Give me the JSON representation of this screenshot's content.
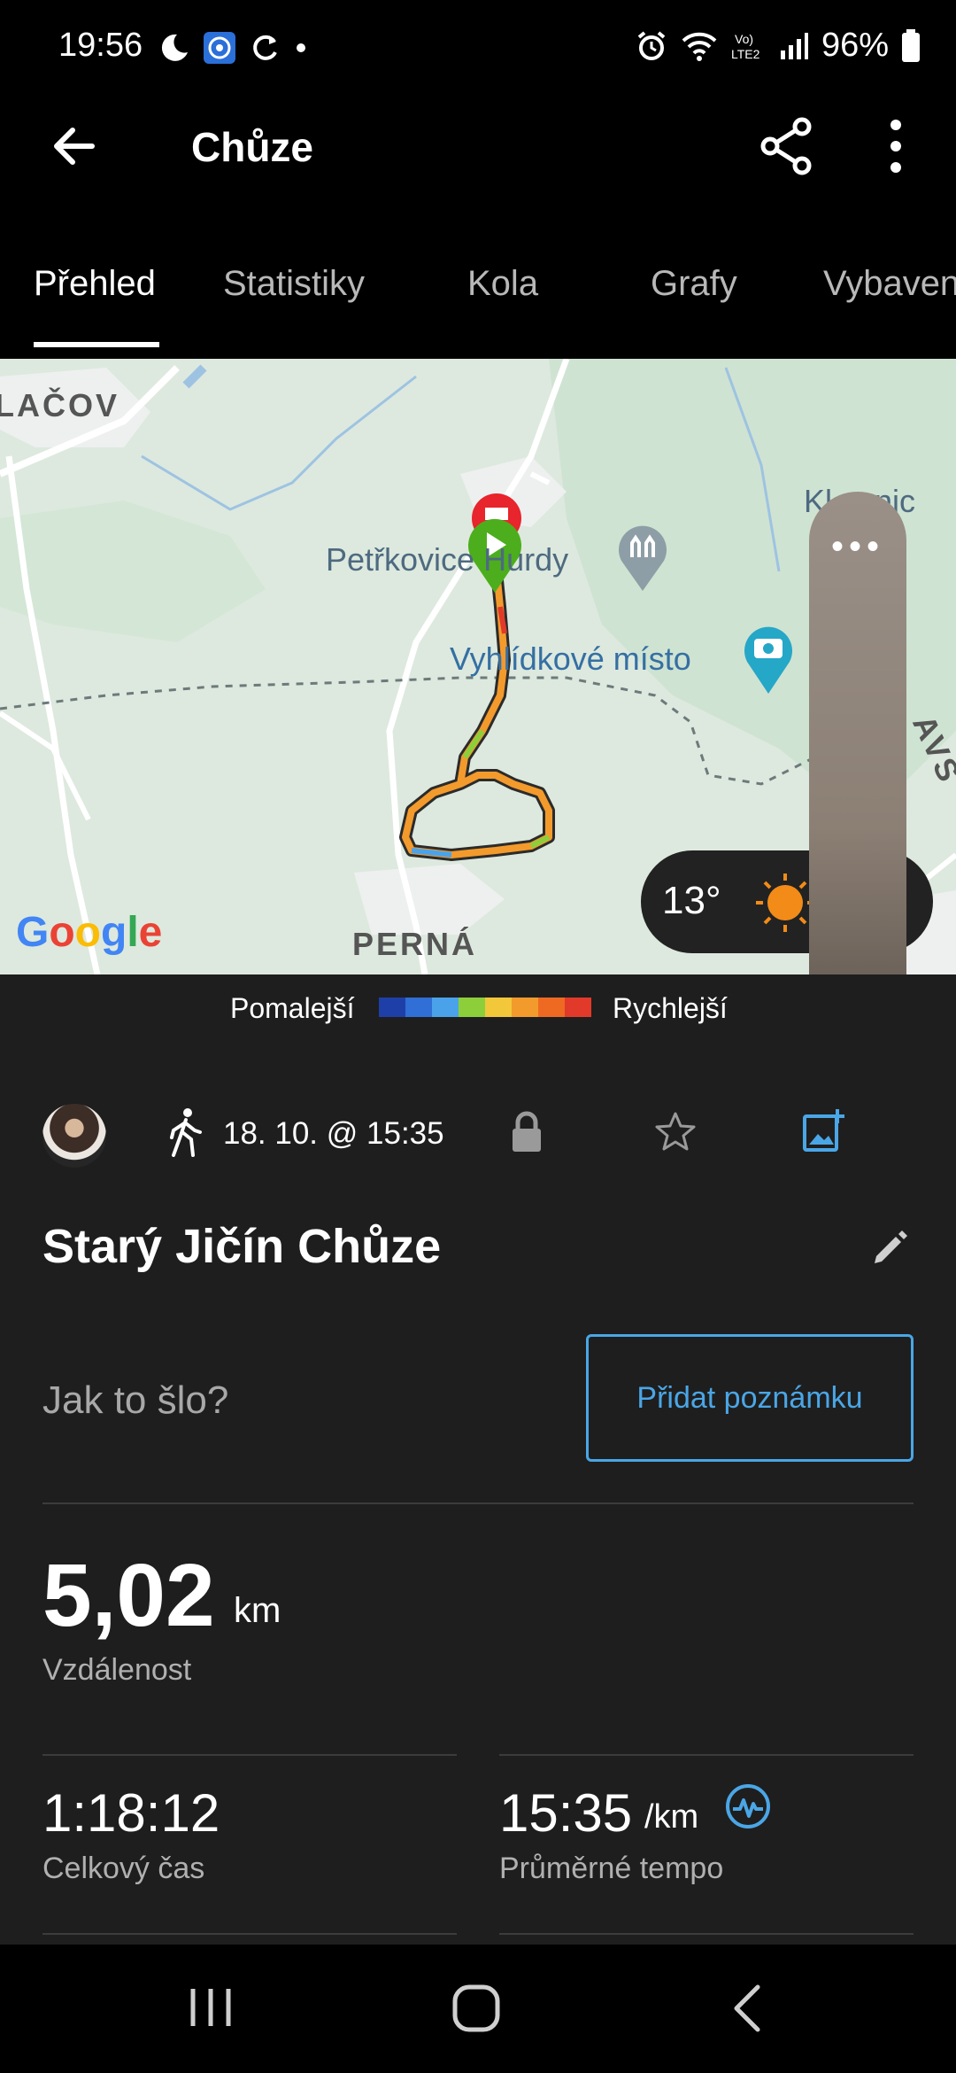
{
  "status_bar": {
    "time": "19:56",
    "battery": "96%",
    "network": "LTE2",
    "icons": [
      "moon-icon",
      "app-notification-icon",
      "sync-icon",
      "dot-icon",
      "alarm-icon",
      "wifi-icon",
      "signal-icon",
      "battery-icon"
    ]
  },
  "app_bar": {
    "title": "Chůze"
  },
  "tabs": [
    {
      "label": "Přehled",
      "active": true
    },
    {
      "label": "Statistiky",
      "active": false
    },
    {
      "label": "Kola",
      "active": false
    },
    {
      "label": "Grafy",
      "active": false
    },
    {
      "label": "Vybaven",
      "active": false
    }
  ],
  "map": {
    "labels": {
      "town_left": "LAČOV",
      "place_top": "Petřkovice Hurdy",
      "viewpoint": "Vyhlídkové místo",
      "town_bottom": "PERNÁ",
      "place_right": "Kl senic",
      "place_right2": "AVS"
    },
    "provider": "Google",
    "weather": {
      "temperature": "13°",
      "icon": "sun-icon"
    },
    "pill_menu": "•••"
  },
  "legend": {
    "slow": "Pomalejší",
    "fast": "Rychlejší",
    "colors": [
      "#1f3fa8",
      "#2f6fd6",
      "#4aa3ea",
      "#8ccf3a",
      "#f2c73a",
      "#f39a2c",
      "#ee6a22",
      "#e23a2a"
    ]
  },
  "activity": {
    "date": "18. 10. @ 15:35",
    "title": "Starý Jičín Chůze",
    "note_prompt": "Jak to šlo?",
    "note_button": "Přidat poznámku",
    "distance": {
      "value": "5,02",
      "unit": "km",
      "label": "Vzdálenost"
    },
    "total_time": {
      "value": "1:18:12",
      "label": "Celkový čas"
    },
    "avg_pace": {
      "value": "15:35",
      "unit": "/km",
      "label": "Průměrné tempo"
    }
  },
  "colors": {
    "accent": "#4aa6e6",
    "background": "#1e1e1e",
    "start_marker": "#4cae1c",
    "end_marker": "#e8242c"
  }
}
